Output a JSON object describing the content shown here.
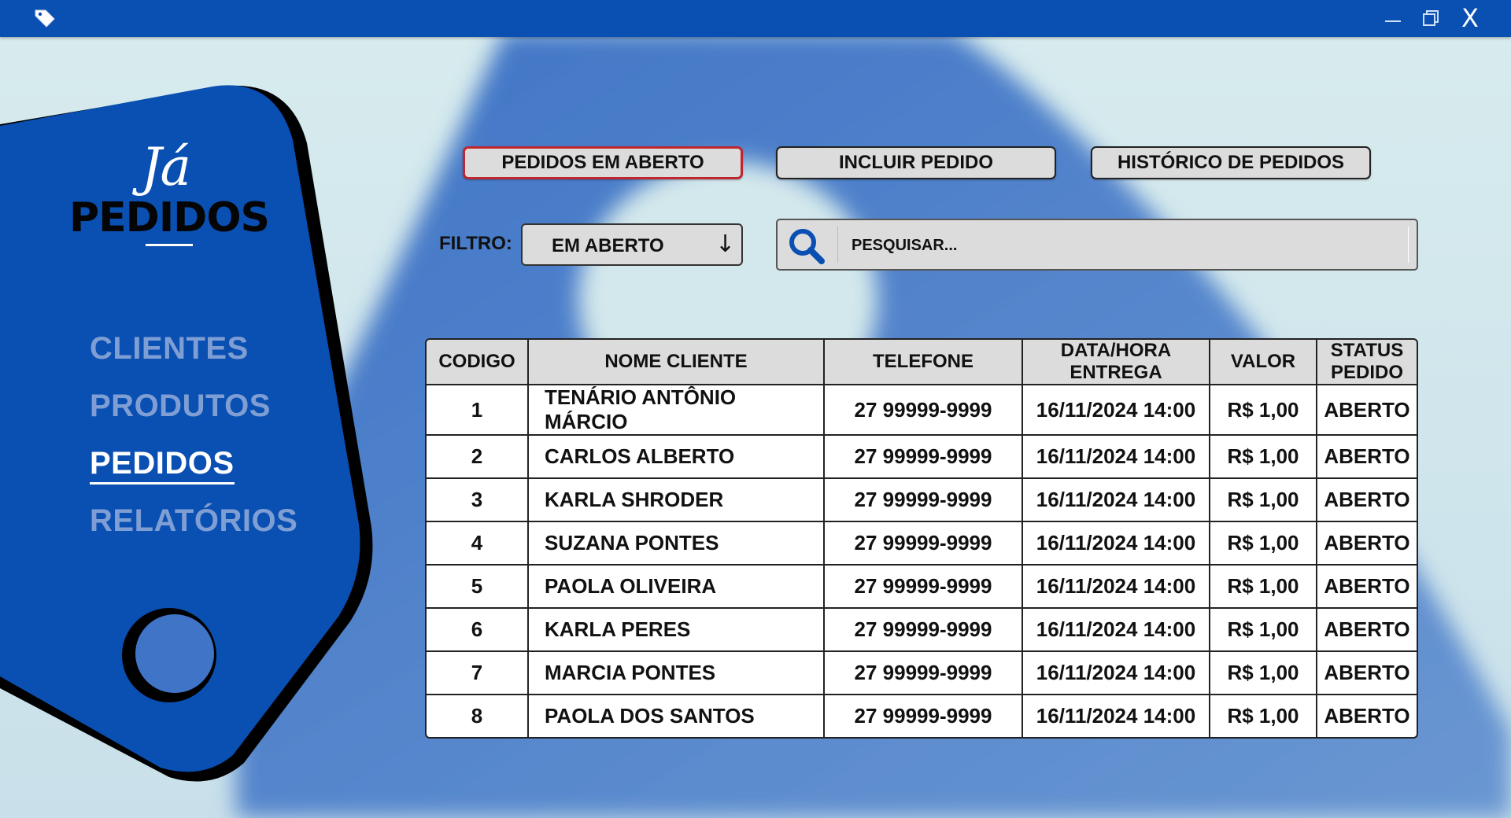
{
  "window": {
    "app_icon": "tag-icon",
    "controls": {
      "minimize": "minimize-icon",
      "maximize": "restore-icon",
      "close_label": "X"
    }
  },
  "brand": {
    "logo_script": "Já",
    "logo_text": "PEDIDOS"
  },
  "sidebar": {
    "items": [
      {
        "label": "CLIENTES",
        "active": false
      },
      {
        "label": "PRODUTOS",
        "active": false
      },
      {
        "label": "PEDIDOS",
        "active": true
      },
      {
        "label": "RELATÓRIOS",
        "active": false
      }
    ]
  },
  "toolbar": {
    "tabs": [
      {
        "label": "PEDIDOS EM ABERTO",
        "active": true
      },
      {
        "label": "INCLUIR PEDIDO",
        "active": false
      },
      {
        "label": "HISTÓRICO DE PEDIDOS",
        "active": false
      }
    ]
  },
  "filter": {
    "label": "FILTRO:",
    "value": "EM ABERTO",
    "arrow": "↓"
  },
  "search": {
    "placeholder": "PESQUISAR...",
    "value": "",
    "icon": "search-icon"
  },
  "table": {
    "headers": [
      "CODIGO",
      "NOME CLIENTE",
      "TELEFONE",
      "DATA/HORA\nENTREGA",
      "VALOR",
      "STATUS\nPEDIDO"
    ],
    "rows": [
      [
        "1",
        "TENÁRIO ANTÔNIO MÁRCIO",
        "27 99999-9999",
        "16/11/2024 14:00",
        "R$ 1,00",
        "ABERTO"
      ],
      [
        "2",
        "CARLOS ALBERTO",
        "27 99999-9999",
        "16/11/2024 14:00",
        "R$ 1,00",
        "ABERTO"
      ],
      [
        "3",
        "KARLA SHRODER",
        "27 99999-9999",
        "16/11/2024 14:00",
        "R$ 1,00",
        "ABERTO"
      ],
      [
        "4",
        "SUZANA PONTES",
        "27 99999-9999",
        "16/11/2024 14:00",
        "R$ 1,00",
        "ABERTO"
      ],
      [
        "5",
        "PAOLA OLIVEIRA",
        "27 99999-9999",
        "16/11/2024 14:00",
        "R$ 1,00",
        "ABERTO"
      ],
      [
        "6",
        "KARLA PERES",
        "27 99999-9999",
        "16/11/2024 14:00",
        "R$ 1,00",
        "ABERTO"
      ],
      [
        "7",
        "MARCIA PONTES",
        "27 99999-9999",
        "16/11/2024 14:00",
        "R$ 1,00",
        "ABERTO"
      ],
      [
        "8",
        "PAOLA DOS SANTOS",
        "27 99999-9999",
        "16/11/2024 14:00",
        "R$ 1,00",
        "ABERTO"
      ]
    ]
  },
  "colors": {
    "brand_blue": "#0a4fb2",
    "active_tab_border": "#c0262d",
    "nav_inactive": "#7f9fd4",
    "nav_active": "#ffffff"
  }
}
